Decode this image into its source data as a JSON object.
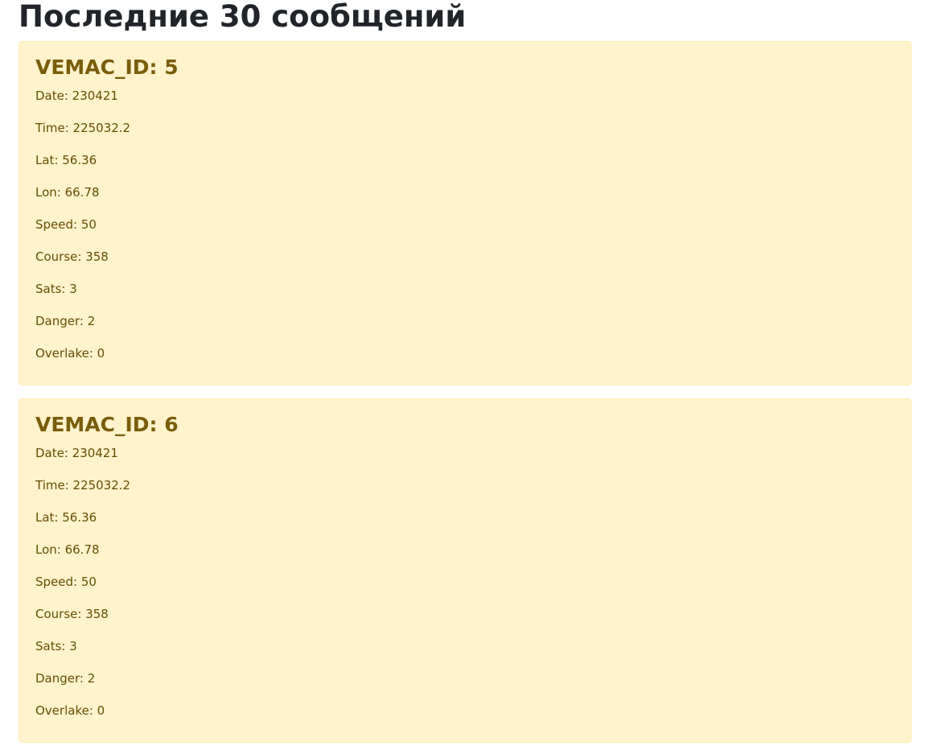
{
  "header": {
    "title": "Последние 30 сообщений"
  },
  "messages": [
    {
      "title": "VEMAC_ID: 5",
      "fields": [
        "Date: 230421",
        "Time: 225032.2",
        "Lat: 56.36",
        "Lon: 66.78",
        "Speed: 50",
        "Course: 358",
        "Sats: 3",
        "Danger: 2",
        "Overlake: 0"
      ]
    },
    {
      "title": "VEMAC_ID: 6",
      "fields": [
        "Date: 230421",
        "Time: 225032.2",
        "Lat: 56.36",
        "Lon: 66.78",
        "Speed: 50",
        "Course: 358",
        "Sats: 3",
        "Danger: 2",
        "Overlake: 0"
      ]
    }
  ],
  "colors": {
    "alert_background": "#fff3cd",
    "alert_border": "#ffecb5",
    "alert_text": "#664d03",
    "heading_text": "#212529"
  }
}
